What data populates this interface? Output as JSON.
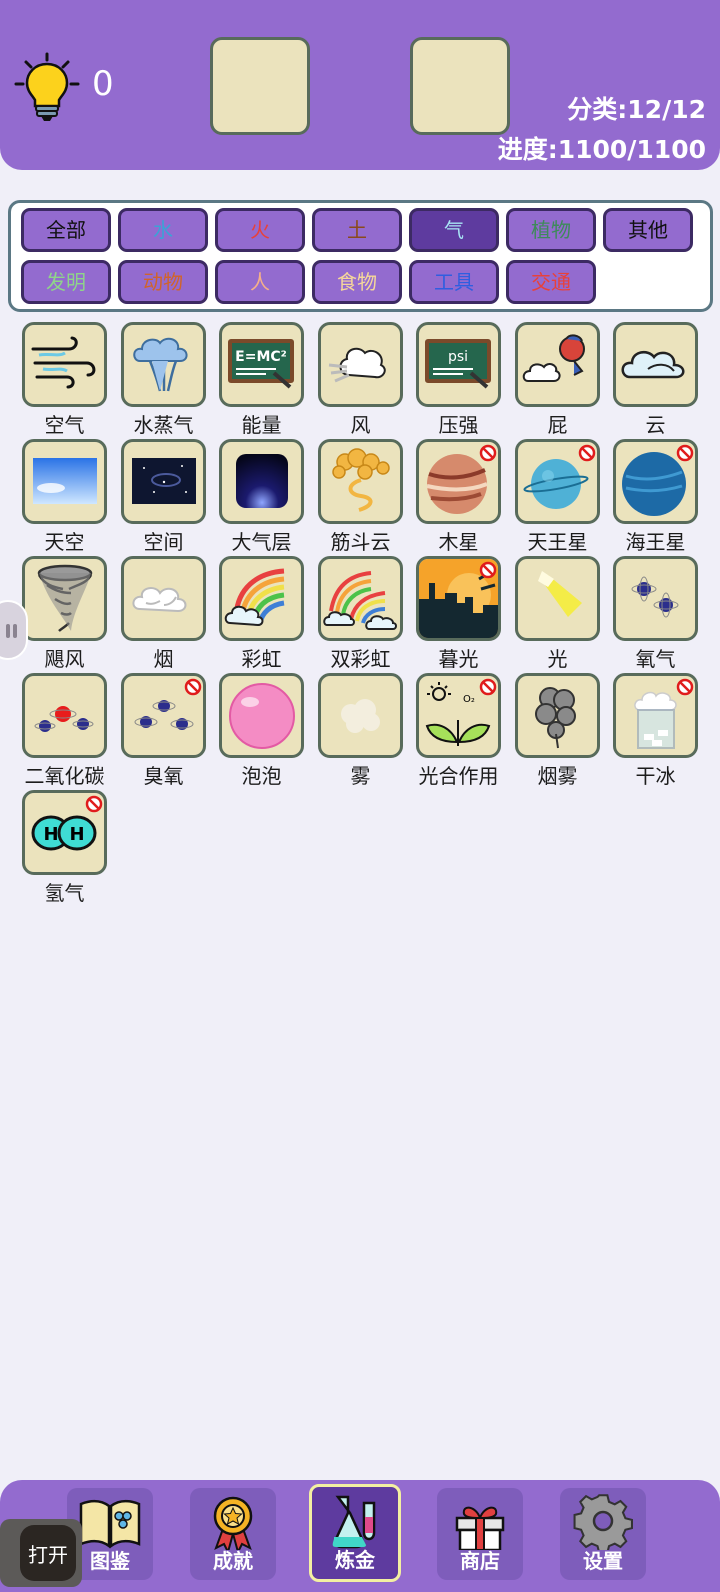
{
  "header": {
    "hint_count": "0",
    "category_stat": "分类:12/12",
    "progress_stat": "进度:1100/1100"
  },
  "colors": {
    "header_bg": "#936bcf",
    "tile_bg": "#ebe3bd",
    "tile_border": "#586b5b",
    "selected_filter": "#5e3b9f",
    "page_bg": "#f0eff8"
  },
  "filters": [
    {
      "label": "全部",
      "color": "#111111",
      "selected": false
    },
    {
      "label": "水",
      "color": "#3ba3d6",
      "selected": false
    },
    {
      "label": "火",
      "color": "#e8413a",
      "selected": false
    },
    {
      "label": "土",
      "color": "#8a4a1c",
      "selected": false
    },
    {
      "label": "气",
      "color": "#a8e4f5",
      "selected": true
    },
    {
      "label": "植物",
      "color": "#3e8a5a",
      "selected": false
    },
    {
      "label": "其他",
      "color": "#111111",
      "selected": false
    },
    {
      "label": "发明",
      "color": "#8fd48a",
      "selected": false
    },
    {
      "label": "动物",
      "color": "#d0642a",
      "selected": false
    },
    {
      "label": "人",
      "color": "#f6b089",
      "selected": false
    },
    {
      "label": "食物",
      "color": "#f5d79a",
      "selected": false
    },
    {
      "label": "工具",
      "color": "#2f5ee0",
      "selected": false
    },
    {
      "label": "交通",
      "color": "#e8413a",
      "selected": false
    }
  ],
  "elements": [
    {
      "name": "空气",
      "icon": "wind-swirl-icon",
      "locked": false
    },
    {
      "name": "水蒸气",
      "icon": "steam-cloud-icon",
      "locked": false
    },
    {
      "name": "能量",
      "icon": "emc2-chalkboard-icon",
      "locked": false
    },
    {
      "name": "风",
      "icon": "wind-cloud-icon",
      "locked": false
    },
    {
      "name": "压强",
      "icon": "psi-chalkboard-icon",
      "locked": false
    },
    {
      "name": "屁",
      "icon": "fart-icon",
      "locked": false
    },
    {
      "name": "云",
      "icon": "cloud-icon",
      "locked": false
    },
    {
      "name": "天空",
      "icon": "sky-icon",
      "locked": false
    },
    {
      "name": "空间",
      "icon": "space-icon",
      "locked": false
    },
    {
      "name": "大气层",
      "icon": "atmosphere-icon",
      "locked": false
    },
    {
      "name": "筋斗云",
      "icon": "magic-cloud-icon",
      "locked": false
    },
    {
      "name": "木星",
      "icon": "jupiter-icon",
      "locked": true
    },
    {
      "name": "天王星",
      "icon": "uranus-icon",
      "locked": true
    },
    {
      "name": "海王星",
      "icon": "neptune-icon",
      "locked": true
    },
    {
      "name": "飓风",
      "icon": "tornado-icon",
      "locked": false
    },
    {
      "name": "烟",
      "icon": "smoke-icon",
      "locked": false
    },
    {
      "name": "彩虹",
      "icon": "rainbow-icon",
      "locked": false
    },
    {
      "name": "双彩虹",
      "icon": "double-rainbow-icon",
      "locked": false
    },
    {
      "name": "暮光",
      "icon": "twilight-icon",
      "locked": true
    },
    {
      "name": "光",
      "icon": "light-beam-icon",
      "locked": false
    },
    {
      "name": "氧气",
      "icon": "oxygen-molecule-icon",
      "locked": false
    },
    {
      "name": "二氧化碳",
      "icon": "co2-molecule-icon",
      "locked": false
    },
    {
      "name": "臭氧",
      "icon": "ozone-molecule-icon",
      "locked": true
    },
    {
      "name": "泡泡",
      "icon": "bubble-icon",
      "locked": false
    },
    {
      "name": "雾",
      "icon": "fog-icon",
      "locked": false
    },
    {
      "name": "光合作用",
      "icon": "photosynthesis-icon",
      "locked": true
    },
    {
      "name": "烟雾",
      "icon": "smog-icon",
      "locked": false
    },
    {
      "name": "干冰",
      "icon": "dry-ice-icon",
      "locked": true
    },
    {
      "name": "氢气",
      "icon": "hydrogen-molecule-icon",
      "locked": true
    }
  ],
  "bottom_nav": [
    {
      "label": "图鉴",
      "icon": "book-icon",
      "selected": false
    },
    {
      "label": "成就",
      "icon": "medal-icon",
      "selected": false
    },
    {
      "label": "炼金",
      "icon": "flask-icon",
      "selected": true
    },
    {
      "label": "商店",
      "icon": "gift-icon",
      "selected": false
    },
    {
      "label": "设置",
      "icon": "gear-icon",
      "selected": false
    }
  ],
  "open_button": {
    "label": "打开"
  }
}
